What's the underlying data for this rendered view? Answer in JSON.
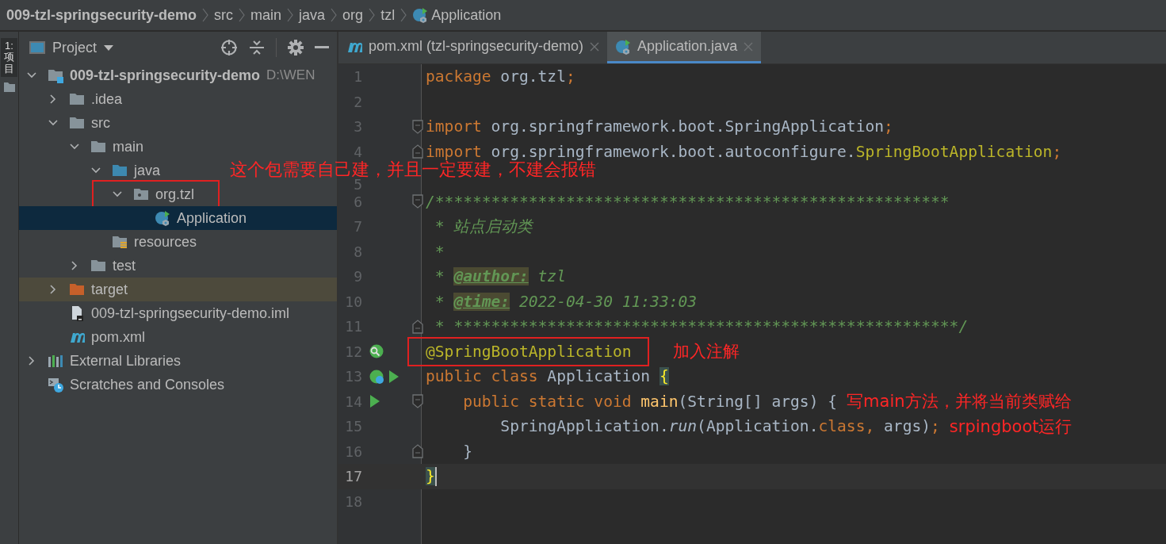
{
  "breadcrumbs": [
    {
      "label": "009-tzl-springsecurity-demo",
      "kind": "project"
    },
    {
      "label": "src",
      "kind": "folder"
    },
    {
      "label": "main",
      "kind": "folder"
    },
    {
      "label": "java",
      "kind": "folder"
    },
    {
      "label": "org",
      "kind": "folder"
    },
    {
      "label": "tzl",
      "kind": "folder"
    },
    {
      "label": "Application",
      "kind": "class"
    }
  ],
  "side_strip": {
    "tab": "1: 项目",
    "selected": true
  },
  "project_panel": {
    "title": "Project",
    "tree": [
      {
        "label": "009-tzl-springsecurity-demo",
        "path": "D:\\WEN",
        "kind": "module",
        "expanded": true,
        "selected": false,
        "children": [
          {
            "label": ".idea",
            "kind": "folder",
            "expanded": false,
            "selected": false
          },
          {
            "label": "src",
            "kind": "folder",
            "expanded": true,
            "selected": false,
            "children": [
              {
                "label": "main",
                "kind": "folder",
                "expanded": true,
                "selected": false,
                "children": [
                  {
                    "label": "java",
                    "kind": "source-folder",
                    "expanded": true,
                    "selected": false,
                    "children": [
                      {
                        "label": "org.tzl",
                        "kind": "package",
                        "expanded": true,
                        "selected": false,
                        "note": "这个包需要自己建，并且一定要建，不建会报错",
                        "children": [
                          {
                            "label": "Application",
                            "kind": "class",
                            "selected": true
                          }
                        ]
                      }
                    ]
                  },
                  {
                    "label": "resources",
                    "kind": "resources-folder",
                    "selected": false
                  }
                ]
              },
              {
                "label": "test",
                "kind": "folder",
                "expanded": false,
                "selected": false
              }
            ]
          },
          {
            "label": "target",
            "kind": "excluded-folder",
            "expanded": false,
            "selected": false
          },
          {
            "label": "009-tzl-springsecurity-demo.iml",
            "kind": "module-file",
            "selected": false
          },
          {
            "label": "pom.xml",
            "kind": "maven-file",
            "selected": false
          }
        ]
      },
      {
        "label": "External Libraries",
        "kind": "libraries",
        "expanded": false,
        "selected": false
      },
      {
        "label": "Scratches and Consoles",
        "kind": "scratches",
        "selected": false
      }
    ]
  },
  "editor_tabs": [
    {
      "label": "pom.xml (tzl-springsecurity-demo)",
      "kind": "maven-file",
      "selected": false
    },
    {
      "label": "Application.java",
      "kind": "class",
      "selected": true
    }
  ],
  "code": [
    {
      "number": "1",
      "tokens": [
        {
          "t": "package",
          "kind": "keyword"
        },
        {
          "t": " org.tzl",
          "kind": "plain"
        },
        {
          "t": ";",
          "kind": "keyword"
        }
      ]
    },
    {
      "number": "2"
    },
    {
      "number": "3",
      "fold_start": true,
      "tokens": [
        {
          "t": "import",
          "kind": "keyword"
        },
        {
          "t": " org.springframework.boot.SpringApplication",
          "kind": "plain"
        },
        {
          "t": ";",
          "kind": "keyword"
        }
      ]
    },
    {
      "number": "4",
      "fold_end": true,
      "tokens": [
        {
          "t": "import",
          "kind": "keyword"
        },
        {
          "t": " org.springframework.boot.autoconfigure.",
          "kind": "plain"
        },
        {
          "t": "SpringBootApplication",
          "kind": "annotation"
        },
        {
          "t": ";",
          "kind": "keyword"
        }
      ]
    },
    {
      "number": "5"
    },
    {
      "number": "6",
      "fold_start": true,
      "tokens": [
        {
          "t": "/*******************************************************",
          "kind": "comment"
        }
      ]
    },
    {
      "number": "7",
      "tokens": [
        {
          "t": " * 站点启动类",
          "kind": "comment"
        }
      ]
    },
    {
      "number": "8",
      "tokens": [
        {
          "t": " *",
          "kind": "comment"
        }
      ]
    },
    {
      "number": "9",
      "tokens": [
        {
          "t": " * ",
          "kind": "comment"
        },
        {
          "t": "@author:",
          "kind": "doctag"
        },
        {
          "t": " tzl",
          "kind": "comment"
        }
      ]
    },
    {
      "number": "10",
      "tokens": [
        {
          "t": " * ",
          "kind": "comment"
        },
        {
          "t": "@time:",
          "kind": "doctag"
        },
        {
          "t": " 2022-04-30 11:33:03",
          "kind": "comment"
        }
      ]
    },
    {
      "number": "11",
      "fold_end": true,
      "tokens": [
        {
          "t": " * ******************************************************/",
          "kind": "comment"
        }
      ]
    },
    {
      "number": "12",
      "bean_search": true,
      "boxed": true,
      "note": "加入注解",
      "tokens": [
        {
          "t": "@SpringBootApplication",
          "kind": "annotation"
        }
      ]
    },
    {
      "number": "13",
      "bean": true,
      "run": true,
      "tokens": [
        {
          "t": "public class ",
          "kind": "keyword"
        },
        {
          "t": "Application ",
          "kind": "plain"
        },
        {
          "t": "{",
          "kind": "brace"
        }
      ]
    },
    {
      "number": "14",
      "run": true,
      "fold_start": true,
      "note": "写main方法，并将当前类赋给",
      "tokens": [
        {
          "t": "    public static void ",
          "kind": "keyword"
        },
        {
          "t": "main",
          "kind": "method"
        },
        {
          "t": "(String[] args) {",
          "kind": "plain"
        }
      ]
    },
    {
      "number": "15",
      "note": "srpingboot运行",
      "tokens": [
        {
          "t": "        SpringApplication.",
          "kind": "plain"
        },
        {
          "t": "run",
          "kind": "italic"
        },
        {
          "t": "(Application.",
          "kind": "plain"
        },
        {
          "t": "class",
          "kind": "keyword"
        },
        {
          "t": ",",
          "kind": "keyword"
        },
        {
          "t": " args)",
          "kind": "plain"
        },
        {
          "t": ";",
          "kind": "keyword"
        }
      ]
    },
    {
      "number": "16",
      "fold_end": true,
      "tokens": [
        {
          "t": "    }",
          "kind": "plain"
        }
      ]
    },
    {
      "number": "17",
      "current": true,
      "tokens": [
        {
          "t": "}",
          "kind": "brace"
        }
      ]
    },
    {
      "number": "18"
    }
  ]
}
